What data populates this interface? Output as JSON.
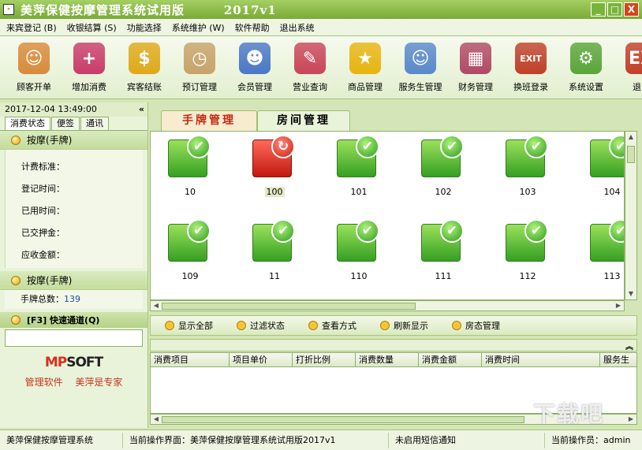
{
  "window": {
    "title": "美萍保健按摩管理系统试用版        2017v1",
    "app_icon": "-",
    "min": "_",
    "max": "□",
    "close": "X"
  },
  "menu": [
    "来宾登记 (B)",
    "收银结算 (S)",
    "功能选择",
    "系统维护 (W)",
    "软件帮助",
    "退出系统"
  ],
  "toolbar": [
    {
      "label": "顾客开单",
      "icon": "customer-icon",
      "color": "#d98a3a",
      "glyph": "☺"
    },
    {
      "label": "增加消费",
      "icon": "add-consumption-icon",
      "color": "#c93c6a",
      "glyph": "+"
    },
    {
      "label": "宾客结账",
      "icon": "checkout-icon",
      "color": "#e0a91a",
      "glyph": "$"
    },
    {
      "label": "预订管理",
      "icon": "clock-icon",
      "color": "#c7a36a",
      "glyph": "◷"
    },
    {
      "label": "会员管理",
      "icon": "members-icon",
      "color": "#4a78c7",
      "glyph": "☻"
    },
    {
      "label": "营业查询",
      "icon": "report-icon",
      "color": "#c9465a",
      "glyph": "✎"
    },
    {
      "label": "商品管理",
      "icon": "star-icon",
      "color": "#e8b410",
      "glyph": "★"
    },
    {
      "label": "服务生管理",
      "icon": "staff-icon",
      "color": "#5a88cc",
      "glyph": "☺"
    },
    {
      "label": "财务管理",
      "icon": "calculator-icon",
      "color": "#b04a66",
      "glyph": "▦"
    },
    {
      "label": "换班登录",
      "icon": "exit-door-icon",
      "color": "#c0402a",
      "glyph": "EXIT"
    },
    {
      "label": "系统设置",
      "icon": "gear-icon",
      "color": "#5aa53a",
      "glyph": "⚙"
    },
    {
      "label": "退出",
      "icon": "exit-icon",
      "color": "#c0402a",
      "glyph": "EX"
    }
  ],
  "left": {
    "datetime": "2017-12-04 13:49:00",
    "collapse": "«",
    "tabs": [
      "消费状态",
      "便签",
      "通讯"
    ],
    "section1": "按摩(手牌)",
    "fields": [
      "计费标准：",
      "登记时间：",
      "已用时间：",
      "已交押金：",
      "应收金额："
    ],
    "section2": "按摩(手牌)",
    "card_count_label": "手牌总数：",
    "card_count": "139",
    "quick_title": "[F3] 快速通道(Q)",
    "logo_a": "MP",
    "logo_b": "SOFT",
    "slogan": "管理软件 美萍是专家"
  },
  "tabs": [
    "手牌管理",
    "房间管理"
  ],
  "rooms": [
    {
      "no": "10",
      "status": "available",
      "glyph": "✔"
    },
    {
      "no": "100",
      "status": "occupied",
      "glyph": "↻"
    },
    {
      "no": "101",
      "status": "available",
      "glyph": "✔"
    },
    {
      "no": "102",
      "status": "available",
      "glyph": "✔"
    },
    {
      "no": "103",
      "status": "available",
      "glyph": "✔"
    },
    {
      "no": "104",
      "status": "available",
      "glyph": "✔"
    },
    {
      "no": "109",
      "status": "available",
      "glyph": "✔"
    },
    {
      "no": "11",
      "status": "available",
      "glyph": "✔"
    },
    {
      "no": "110",
      "status": "available",
      "glyph": "✔"
    },
    {
      "no": "111",
      "status": "available",
      "glyph": "✔"
    },
    {
      "no": "112",
      "status": "available",
      "glyph": "✔"
    },
    {
      "no": "113",
      "status": "available",
      "glyph": "✔"
    }
  ],
  "actions": [
    "显示全部",
    "过滤状态",
    "查看方式",
    "刷新显示",
    "房态管理"
  ],
  "lower_toggle": "︽",
  "columns": [
    "消费项目",
    "项目单价",
    "打折比例",
    "消费数量",
    "消费金额",
    "消费时间",
    "服务生"
  ],
  "status": [
    "美萍保健按摩管理系统",
    "当前操作界面：美萍保健按摩管理系统试用版2017v1",
    "未启用短信通知",
    "当前操作员：admin"
  ],
  "watermark": "下载吧"
}
